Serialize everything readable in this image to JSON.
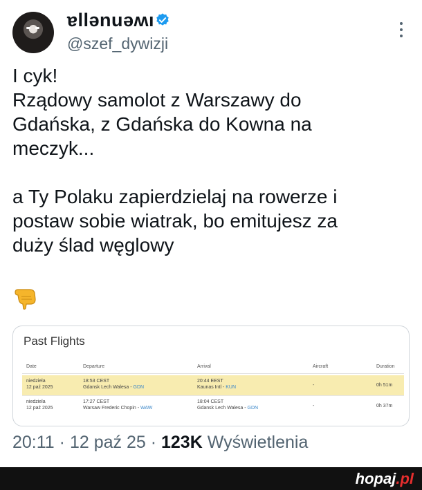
{
  "tweet": {
    "display_name": "ɐllǝnuǝʍı",
    "handle": "@szef_dywizji",
    "lines": [
      "I cyk!",
      "Rządowy samolot z Warszawy do",
      "Gdańska, z Gdańska do Kowna na",
      "meczyk...",
      "a Ty Polaku zapierdzielaj na rowerze i",
      "postaw sobie wiatrak, bo emitujesz za",
      "duży ślad węglowy"
    ],
    "emoji": "point-down-left-emoji",
    "meta": {
      "time": "20:11",
      "sep1": " · ",
      "date": "12 paź 25",
      "sep2": " · ",
      "views": "123K",
      "views_label": " Wyświetlenia"
    }
  },
  "flights": {
    "title": "Past Flights",
    "columns": [
      "Date",
      "Departure",
      "Arrival",
      "Aircraft",
      "Duration"
    ],
    "rows": [
      {
        "date_day": "niedziela",
        "date": "12 paź 2025",
        "dep_time": "18:53 CEST",
        "dep_airport": "Gdansk Lech Walesa - ",
        "dep_code": "GDN",
        "arr_time": "20:44 EEST",
        "arr_airport": "Kaunas Intl - ",
        "arr_code": "KUN",
        "aircraft": "-",
        "duration": "0h 51m"
      },
      {
        "date_day": "niedziela",
        "date": "12 paź 2025",
        "dep_time": "17:27 CEST",
        "dep_airport": "Warsaw Frederic Chopin - ",
        "dep_code": "WAW",
        "arr_time": "18:04 CEST",
        "arr_airport": "Gdansk Lech Walesa - ",
        "arr_code": "GDN",
        "aircraft": "-",
        "duration": "0h 37m"
      }
    ]
  },
  "footer": {
    "brand_main": "hopaj",
    "brand_tld": ".pl"
  },
  "colors": {
    "highlight_row": "#f8ecb0",
    "verified_blue": "#1d9bf0",
    "muted_text": "#536471"
  }
}
